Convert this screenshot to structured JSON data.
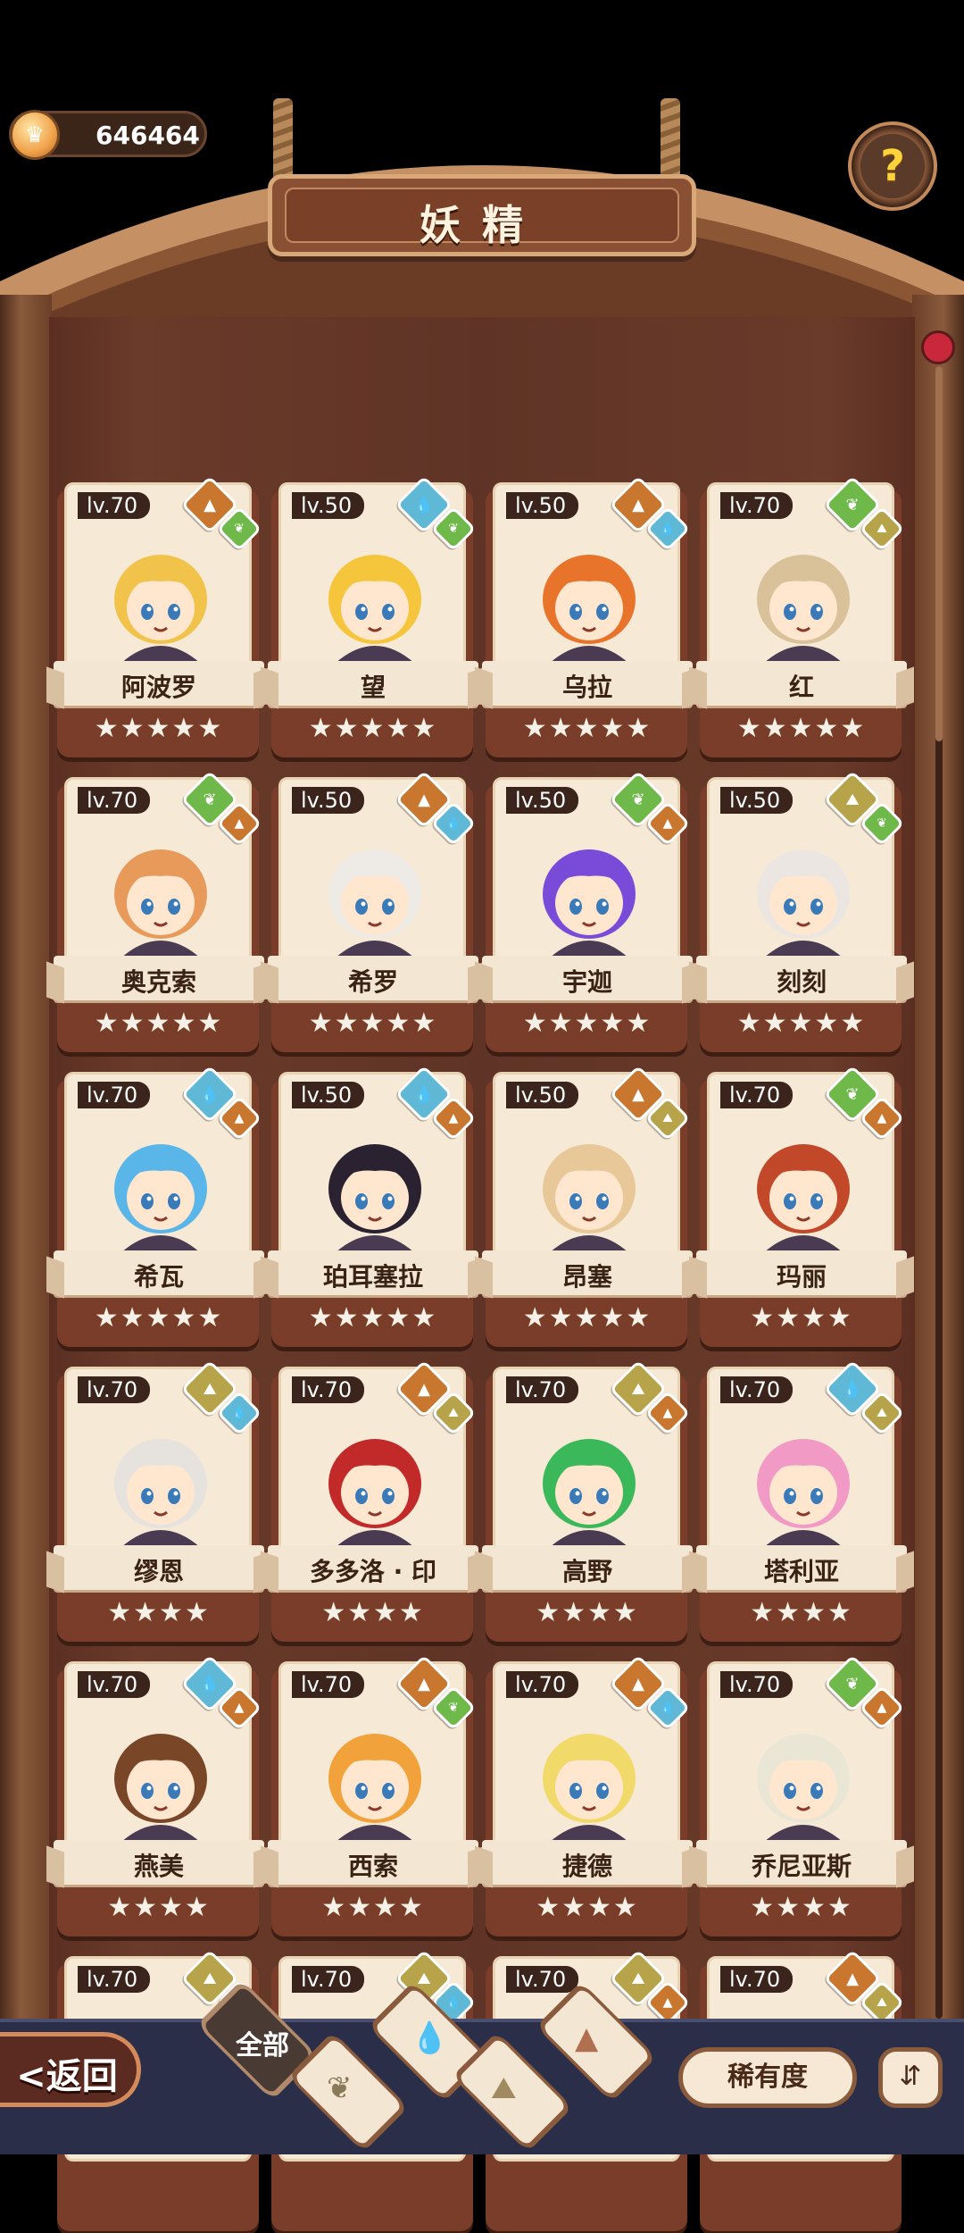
{
  "header": {
    "coins": "646464",
    "title": "妖精",
    "help_glyph": "?"
  },
  "colors": {
    "fire": "#c9762f",
    "water": "#5fb9d6",
    "leaf": "#6fb84a",
    "earth": "#b7a44a",
    "card": "#7a3d2a",
    "paper": "#f6e9d6"
  },
  "cards": [
    {
      "level": "lv.70",
      "name": "阿波罗",
      "stars": "★★★★★",
      "elements": [
        "fire",
        "leaf"
      ],
      "hair": "#f2c34a"
    },
    {
      "level": "lv.50",
      "name": "望",
      "stars": "★★★★★",
      "elements": [
        "water",
        "leaf"
      ],
      "hair": "#f5c63c"
    },
    {
      "level": "lv.50",
      "name": "乌拉",
      "stars": "★★★★★",
      "elements": [
        "fire",
        "water"
      ],
      "hair": "#e8742c"
    },
    {
      "level": "lv.70",
      "name": "红",
      "stars": "★★★★★",
      "elements": [
        "leaf",
        "earth"
      ],
      "hair": "#d9c29a"
    },
    {
      "level": "lv.70",
      "name": "奥克索",
      "stars": "★★★★★",
      "elements": [
        "leaf",
        "fire"
      ],
      "hair": "#e89a5a"
    },
    {
      "level": "lv.50",
      "name": "希罗",
      "stars": "★★★★★",
      "elements": [
        "fire",
        "water"
      ],
      "hair": "#eeeae6"
    },
    {
      "level": "lv.50",
      "name": "宇迦",
      "stars": "★★★★★",
      "elements": [
        "leaf",
        "fire"
      ],
      "hair": "#7a4ad8"
    },
    {
      "level": "lv.50",
      "name": "刻刻",
      "stars": "★★★★★",
      "elements": [
        "earth",
        "leaf"
      ],
      "hair": "#ece6e2"
    },
    {
      "level": "lv.70",
      "name": "希瓦",
      "stars": "★★★★★",
      "elements": [
        "water",
        "fire"
      ],
      "hair": "#5ab6e8"
    },
    {
      "level": "lv.50",
      "name": "珀耳塞拉",
      "stars": "★★★★★",
      "elements": [
        "water",
        "fire"
      ],
      "hair": "#2a2230"
    },
    {
      "level": "lv.50",
      "name": "昂塞",
      "stars": "★★★★★",
      "elements": [
        "fire",
        "earth"
      ],
      "hair": "#e8c898"
    },
    {
      "level": "lv.70",
      "name": "玛丽",
      "stars": "★★★★",
      "elements": [
        "leaf",
        "fire"
      ],
      "hair": "#c2482a"
    },
    {
      "level": "lv.70",
      "name": "缪恩",
      "stars": "★★★★",
      "elements": [
        "earth",
        "water"
      ],
      "hair": "#e6e2de"
    },
    {
      "level": "lv.70",
      "name": "多多洛 · 印",
      "stars": "★★★★",
      "elements": [
        "fire",
        "earth"
      ],
      "hair": "#c22a2a"
    },
    {
      "level": "lv.70",
      "name": "高野",
      "stars": "★★★★",
      "elements": [
        "earth",
        "fire"
      ],
      "hair": "#3ab85a"
    },
    {
      "level": "lv.70",
      "name": "塔利亚",
      "stars": "★★★★",
      "elements": [
        "water",
        "earth"
      ],
      "hair": "#f29ac6"
    },
    {
      "level": "lv.70",
      "name": "燕美",
      "stars": "★★★★",
      "elements": [
        "water",
        "fire"
      ],
      "hair": "#7a4628"
    },
    {
      "level": "lv.70",
      "name": "西索",
      "stars": "★★★★",
      "elements": [
        "fire",
        "leaf"
      ],
      "hair": "#f2a23a"
    },
    {
      "level": "lv.70",
      "name": "捷德",
      "stars": "★★★★",
      "elements": [
        "fire",
        "water"
      ],
      "hair": "#f2da6a"
    },
    {
      "level": "lv.70",
      "name": "乔尼亚斯",
      "stars": "★★★★",
      "elements": [
        "leaf",
        "fire"
      ],
      "hair": "#eae6d6"
    },
    {
      "level": "lv.70",
      "name": "",
      "stars": "",
      "elements": [
        "earth",
        "fire"
      ],
      "hair": "#e8e0a0"
    },
    {
      "level": "lv.70",
      "name": "",
      "stars": "",
      "elements": [
        "earth",
        "water"
      ],
      "hair": "#c8d8c0"
    },
    {
      "level": "lv.70",
      "name": "",
      "stars": "",
      "elements": [
        "earth",
        "fire"
      ],
      "hair": "#8a5ac8"
    },
    {
      "level": "lv.70",
      "name": "",
      "stars": "",
      "elements": [
        "fire",
        "earth"
      ],
      "hair": "#d8b878"
    }
  ],
  "bottom": {
    "back_label": "<返回",
    "filter_all_label": "全部",
    "rarity_label": "稀有度",
    "sort_glyph": "⇵"
  }
}
